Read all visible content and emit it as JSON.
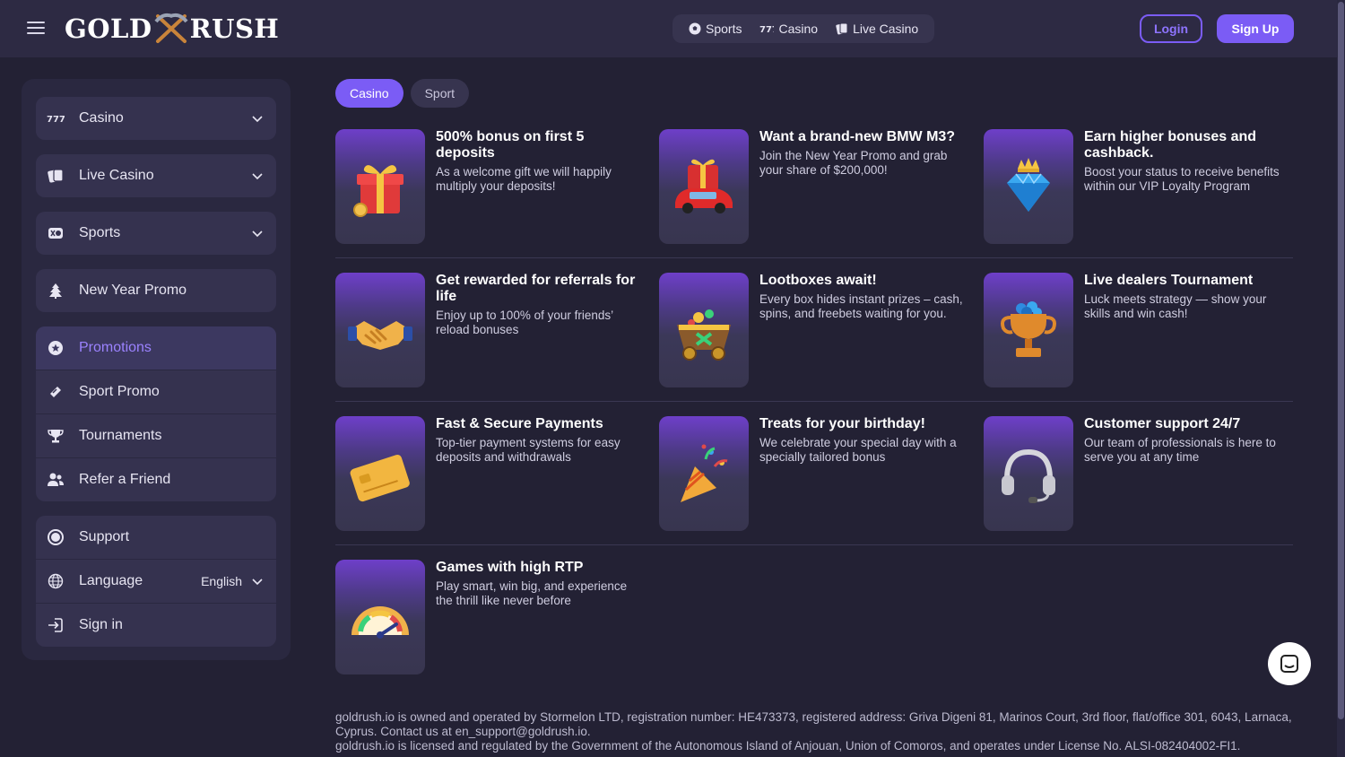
{
  "brand": {
    "left": "GOLD",
    "right": "RUSH"
  },
  "topnav": [
    {
      "label": "Sports",
      "icon": "soccer-ball-icon"
    },
    {
      "label": "Casino",
      "icon": "slot-777-icon"
    },
    {
      "label": "Live Casino",
      "icon": "cards-icon"
    }
  ],
  "auth": {
    "login": "Login",
    "signup": "Sign Up"
  },
  "sidebar": {
    "casino": "Casino",
    "live_casino": "Live Casino",
    "sports": "Sports",
    "new_year": "New Year Promo",
    "promotions": "Promotions",
    "sport_promo": "Sport Promo",
    "tournaments": "Tournaments",
    "refer": "Refer a Friend",
    "support": "Support",
    "language": "Language",
    "language_value": "English",
    "sign_in": "Sign in"
  },
  "tabs": {
    "casino": "Casino",
    "sport": "Sport"
  },
  "promos": [
    {
      "title": "500% bonus on first 5 deposits",
      "text": "As a welcome gift we will happily multiply your deposits!",
      "icon": "gift-icon"
    },
    {
      "title": "Want a brand-new BMW M3?",
      "text": "Join the New Year Promo and grab your share of $200,000!",
      "icon": "car-gift-icon"
    },
    {
      "title": "Earn higher bonuses and cashback.",
      "text": "Boost your status to receive benefits within our VIP Loyalty Program",
      "icon": "crown-diamond-icon"
    },
    {
      "title": "Get rewarded for referrals for life",
      "text": "Enjoy up to 100% of your friends’ reload bonuses",
      "icon": "handshake-icon"
    },
    {
      "title": "Lootboxes await!",
      "text": "Every box hides instant prizes – cash, spins, and freebets waiting for you.",
      "icon": "lootbox-cart-icon"
    },
    {
      "title": "Live dealers Tournament",
      "text": "Luck meets strategy — show your skills and win cash!",
      "icon": "trophy-icon"
    },
    {
      "title": "Fast & Secure Payments",
      "text": "Top-tier payment systems for easy deposits and withdrawals",
      "icon": "credit-card-icon"
    },
    {
      "title": "Treats for your birthday!",
      "text": "We celebrate your special day with a specially tailored bonus",
      "icon": "party-popper-icon"
    },
    {
      "title": "Customer support 24/7",
      "text": "Our team of professionals is here to serve you at any time",
      "icon": "headset-icon"
    },
    {
      "title": "Games with high RTP",
      "text": "Play smart, win big, and experience the thrill like never before",
      "icon": "gauge-icon"
    }
  ],
  "footer": {
    "line1": "goldrush.io is owned and operated by Stormelon LTD, registration number: HE473373, registered address: Griva Digeni 81, Marinos Court, 3rd floor, flat/office 301, 6043, Larnaca, Cyprus. Contact us at ",
    "email": "en_support@goldrush.io",
    "line1_end": ".",
    "line2": "goldrush.io is licensed and regulated by the Government of the Autonomous Island of Anjouan, Union of Comoros, and operates under License No. ALSI-082404002-FI1."
  },
  "colors": {
    "accent": "#7b5cf5",
    "bg": "#232134",
    "panel": "#35324f"
  }
}
